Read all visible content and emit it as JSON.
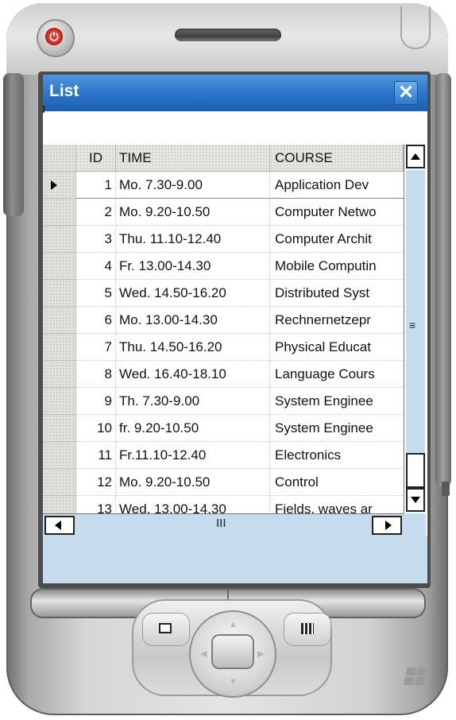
{
  "window": {
    "title": "List",
    "close_label": "✕"
  },
  "grid": {
    "columns": [
      "ID",
      "TIME",
      "COURSE"
    ],
    "rows": [
      {
        "id": "1",
        "time": "Mo. 7.30-9.00",
        "course": "Application Dev"
      },
      {
        "id": "2",
        "time": "Mo. 9.20-10.50",
        "course": "Computer Netwo"
      },
      {
        "id": "3",
        "time": "Thu. 11.10-12.40",
        "course": "Computer Archit"
      },
      {
        "id": "4",
        "time": "Fr. 13.00-14.30",
        "course": "Mobile Computin"
      },
      {
        "id": "5",
        "time": "Wed. 14.50-16.20",
        "course": "Distributed Syst"
      },
      {
        "id": "6",
        "time": "Mo. 13.00-14.30",
        "course": "Rechnernetzepr"
      },
      {
        "id": "7",
        "time": "Thu. 14.50-16.20",
        "course": "Physical Educat"
      },
      {
        "id": "8",
        "time": "Wed. 16.40-18.10",
        "course": "Language Cours"
      },
      {
        "id": "9",
        "time": "Th. 7.30-9.00",
        "course": "System Enginee"
      },
      {
        "id": "10",
        "time": "fr. 9.20-10.50",
        "course": "System Enginee"
      },
      {
        "id": "11",
        "time": "Fr.11.10-12.40",
        "course": "Electronics"
      },
      {
        "id": "12",
        "time": "Mo. 9.20-10.50",
        "course": "Control"
      },
      {
        "id": "13",
        "time": "Wed. 13.00-14.30",
        "course": "Fields, waves ar"
      }
    ],
    "selected_row": 0
  },
  "scrollbars": {
    "vertical_grip": "≡",
    "horizontal_grip": "III"
  },
  "colors": {
    "titlebar": "#2a73c8",
    "screen_background": "#c7dcec",
    "power_button": "#e0352b"
  },
  "icons": [
    "power-icon",
    "close-icon",
    "lock-icon",
    "scroll-up-icon",
    "scroll-down-icon",
    "scroll-left-icon",
    "scroll-right-icon",
    "contacts-icon",
    "calendar-icon",
    "windows-logo-icon"
  ]
}
